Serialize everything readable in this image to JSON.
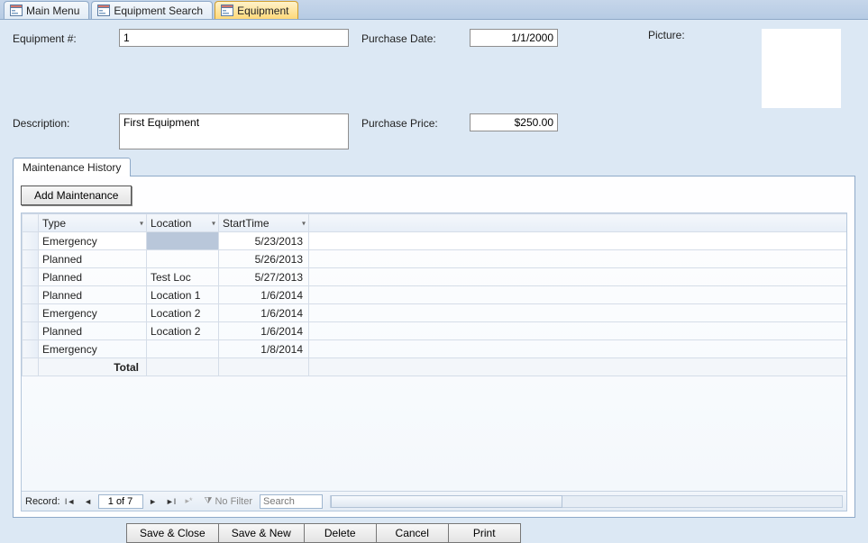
{
  "tabs": [
    {
      "label": "Main Menu",
      "active": false
    },
    {
      "label": "Equipment Search",
      "active": false
    },
    {
      "label": "Equipment",
      "active": true
    }
  ],
  "form": {
    "equipment_num_label": "Equipment #:",
    "equipment_num": "1",
    "description_label": "Description:",
    "description": "First Equipment",
    "purchase_date_label": "Purchase Date:",
    "purchase_date": "1/1/2000",
    "purchase_price_label": "Purchase Price:",
    "purchase_price": "$250.00",
    "picture_label": "Picture:"
  },
  "subtab": {
    "label": "Maintenance History"
  },
  "add_maint_label": "Add Maintenance",
  "grid": {
    "columns": {
      "type": "Type",
      "location": "Location",
      "start": "StartTime"
    },
    "rows": [
      {
        "type": "Emergency",
        "location": "",
        "start": "5/23/2013",
        "selected": true
      },
      {
        "type": "Planned",
        "location": "",
        "start": "5/26/2013"
      },
      {
        "type": "Planned",
        "location": "Test Loc",
        "start": "5/27/2013"
      },
      {
        "type": "Planned",
        "location": "Location 1",
        "start": "1/6/2014"
      },
      {
        "type": "Emergency",
        "location": "Location 2",
        "start": "1/6/2014"
      },
      {
        "type": "Planned",
        "location": "Location 2",
        "start": "1/6/2014"
      },
      {
        "type": "Emergency",
        "location": "",
        "start": "1/8/2014"
      }
    ],
    "total_label": "Total"
  },
  "recnav": {
    "label": "Record:",
    "position": "1 of 7",
    "no_filter": "No Filter",
    "search_placeholder": "Search"
  },
  "buttons": {
    "save_close": "Save & Close",
    "save_new": "Save & New",
    "delete": "Delete",
    "cancel": "Cancel",
    "print": "Print"
  }
}
